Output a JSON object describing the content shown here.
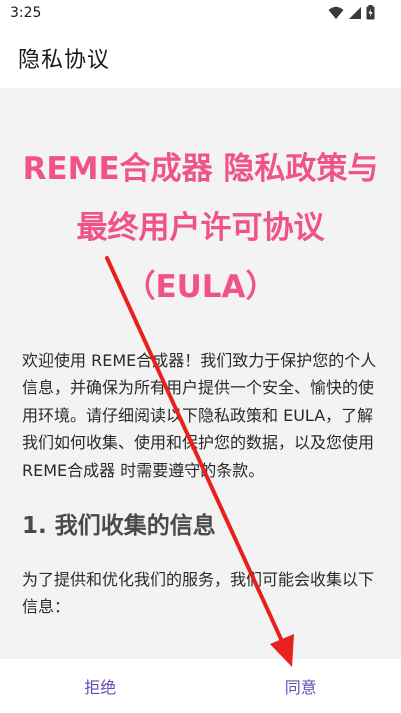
{
  "status_bar": {
    "time": "3:25",
    "icons": [
      "wifi-icon",
      "signal-icon",
      "battery-icon"
    ]
  },
  "app_bar": {
    "title": "隐私协议"
  },
  "document": {
    "title": "REME合成器 隐私政策与最终用户许可协议（EULA）",
    "intro": "欢迎使用 REME合成器！我们致力于保护您的个人信息，并确保为所有用户提供一个安全、愉快的使用环境。请仔细阅读以下隐私政策和 EULA，了解我们如何收集、使用和保护您的数据，以及您使用 REME合成器 时需要遵守的条款。",
    "section_1_heading": "1. 我们收集的信息",
    "section_1_body": "为了提供和优化我们的服务，我们可能会收集以下信息："
  },
  "actions": {
    "reject_label": "拒绝",
    "agree_label": "同意"
  },
  "colors": {
    "title_pink": "#f0538a",
    "button_purple": "#6a4bb4",
    "annotation_red": "#e8211e"
  }
}
